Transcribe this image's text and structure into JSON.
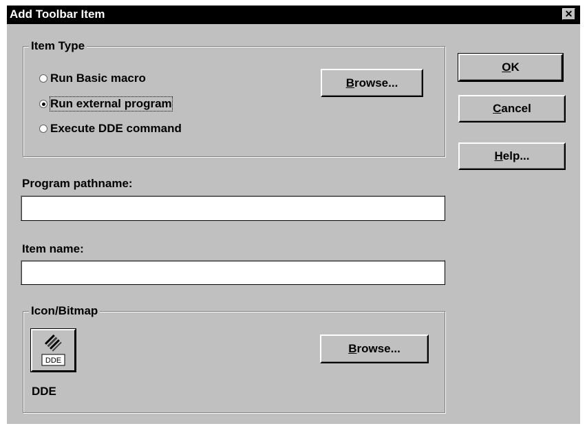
{
  "window": {
    "title": "Add Toolbar Item",
    "close_glyph": "✕"
  },
  "item_type": {
    "legend": "Item Type",
    "options": [
      {
        "label": "Run Basic macro",
        "selected": false
      },
      {
        "label": "Run external program",
        "selected": true
      },
      {
        "label": "Execute DDE command",
        "selected": false
      }
    ],
    "browse_pre": "",
    "browse_key": "B",
    "browse_post": "rowse..."
  },
  "buttons": {
    "ok_key": "O",
    "ok_post": "K",
    "cancel_key": "C",
    "cancel_post": "ancel",
    "help_key": "H",
    "help_post": "elp..."
  },
  "program_pathname": {
    "label": "Program pathname:",
    "value": ""
  },
  "item_name": {
    "label": "Item name:",
    "value": ""
  },
  "icon_bitmap": {
    "legend": "Icon/Bitmap",
    "icon_caption": "DDE",
    "icon_name": "dde-icon",
    "name": "DDE",
    "browse_key": "B",
    "browse_post": "rowse..."
  }
}
